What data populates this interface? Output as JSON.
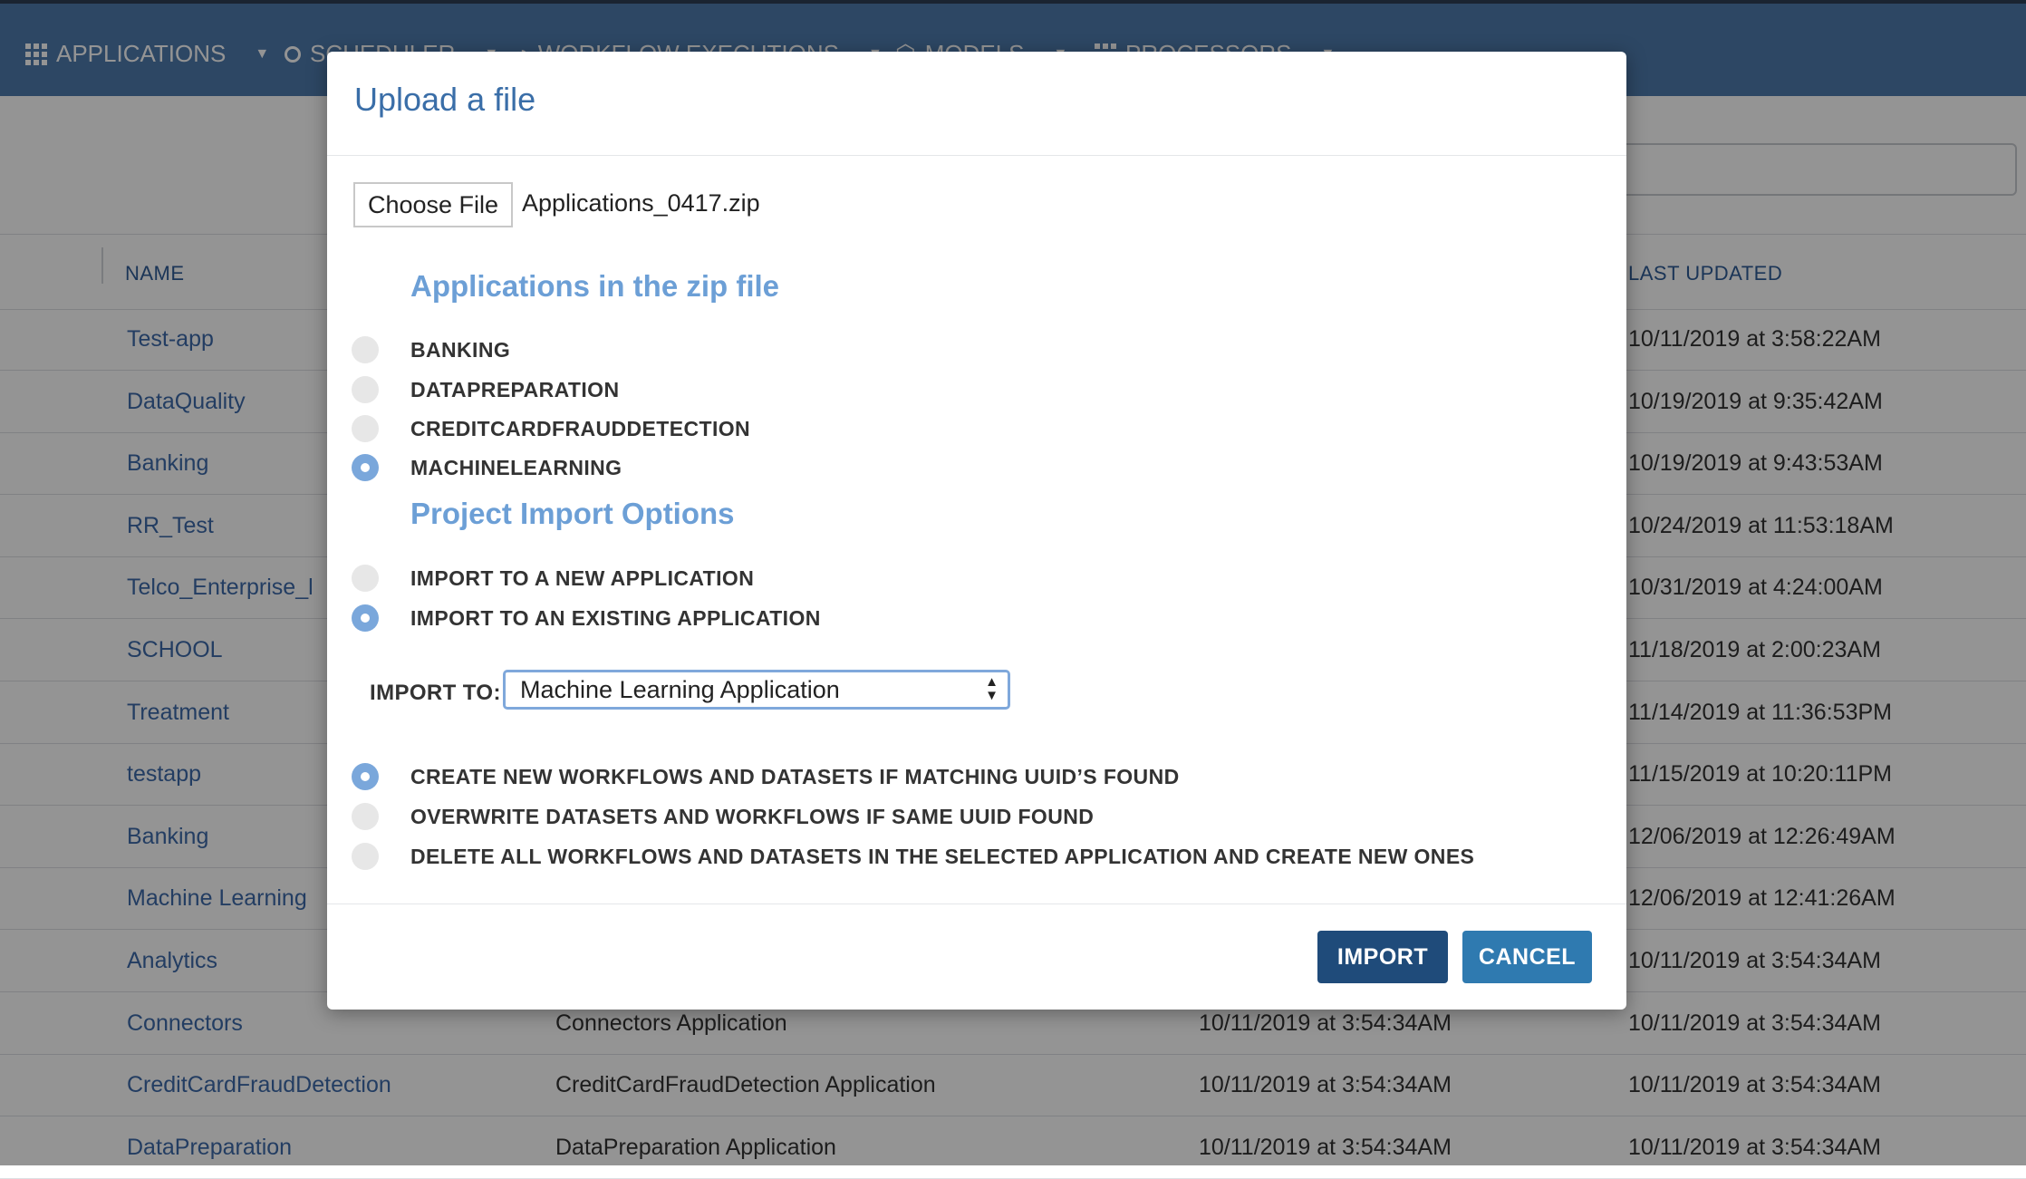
{
  "nav": {
    "applications": "APPLICATIONS",
    "scheduler": "SCHEDULER",
    "workflow_executions": "WORKFLOW EXECUTIONS",
    "models": "MODELS",
    "processors": "PROCESSORS"
  },
  "table": {
    "headers": {
      "name": "NAME",
      "last_updated": "LAST UPDATED"
    },
    "rows": [
      {
        "name": "Test-app",
        "description": "",
        "created": "",
        "updated": "10/11/2019 at 3:58:22AM"
      },
      {
        "name": "DataQuality",
        "description": "",
        "created": "",
        "updated": "10/19/2019 at 9:35:42AM"
      },
      {
        "name": "Banking",
        "description": "",
        "created": "",
        "updated": "10/19/2019 at 9:43:53AM"
      },
      {
        "name": "RR_Test",
        "description": "",
        "created": "",
        "updated": "10/24/2019 at 11:53:18AM"
      },
      {
        "name": "Telco_Enterprise_l",
        "description": "",
        "created": "",
        "updated": "10/31/2019 at 4:24:00AM"
      },
      {
        "name": "SCHOOL",
        "description": "",
        "created": "",
        "updated": "11/18/2019 at 2:00:23AM"
      },
      {
        "name": "Treatment",
        "description": "",
        "created": "",
        "updated": "11/14/2019 at 11:36:53PM"
      },
      {
        "name": "testapp",
        "description": "",
        "created": "",
        "updated": "11/15/2019 at 10:20:11PM"
      },
      {
        "name": "Banking",
        "description": "",
        "created": "",
        "updated": "12/06/2019 at 12:26:49AM"
      },
      {
        "name": "Machine Learning",
        "description": "",
        "created": "",
        "updated": "12/06/2019 at 12:41:26AM"
      },
      {
        "name": "Analytics",
        "description": "",
        "created": "",
        "updated": "10/11/2019 at 3:54:34AM"
      },
      {
        "name": "Connectors",
        "description": "Connectors Application",
        "created": "10/11/2019 at 3:54:34AM",
        "updated": "10/11/2019 at 3:54:34AM"
      },
      {
        "name": "CreditCardFraudDetection",
        "description": "CreditCardFraudDetection Application",
        "created": "10/11/2019 at 3:54:34AM",
        "updated": "10/11/2019 at 3:54:34AM"
      },
      {
        "name": "DataPreparation",
        "description": "DataPreparation Application",
        "created": "10/11/2019 at 3:54:34AM",
        "updated": "10/11/2019 at 3:54:34AM"
      }
    ]
  },
  "modal": {
    "title": "Upload a file",
    "choose_file_label": "Choose File",
    "file_name": "Applications_0417.zip",
    "apps_section_title": "Applications in the zip file",
    "apps": [
      {
        "label": "BANKING",
        "selected": false
      },
      {
        "label": "DATAPREPARATION",
        "selected": false
      },
      {
        "label": "CREDITCARDFRAUDDETECTION",
        "selected": false
      },
      {
        "label": "MACHINELEARNING",
        "selected": true
      }
    ],
    "options_section_title": "Project Import Options",
    "import_modes": [
      {
        "label": "IMPORT TO A NEW APPLICATION",
        "selected": false
      },
      {
        "label": "IMPORT TO AN EXISTING APPLICATION",
        "selected": true
      }
    ],
    "import_to_label": "IMPORT TO:",
    "import_to_value": "Machine Learning Application",
    "conflict_options": [
      {
        "label": "CREATE NEW WORKFLOWS AND DATASETS IF MATCHING UUID’S FOUND",
        "selected": true
      },
      {
        "label": "OVERWRITE DATASETS AND WORKFLOWS IF SAME UUID FOUND",
        "selected": false
      },
      {
        "label": "DELETE ALL WORKFLOWS AND DATASETS IN THE SELECTED APPLICATION AND CREATE NEW ONES",
        "selected": false
      }
    ],
    "import_button": "IMPORT",
    "cancel_button": "CANCEL"
  },
  "colors": {
    "topbar": "#4f7aad",
    "link": "#3d6aa9",
    "section_title": "#6c9fd6",
    "import_button": "#1f4b7a",
    "cancel_button": "#2f7ab0"
  }
}
